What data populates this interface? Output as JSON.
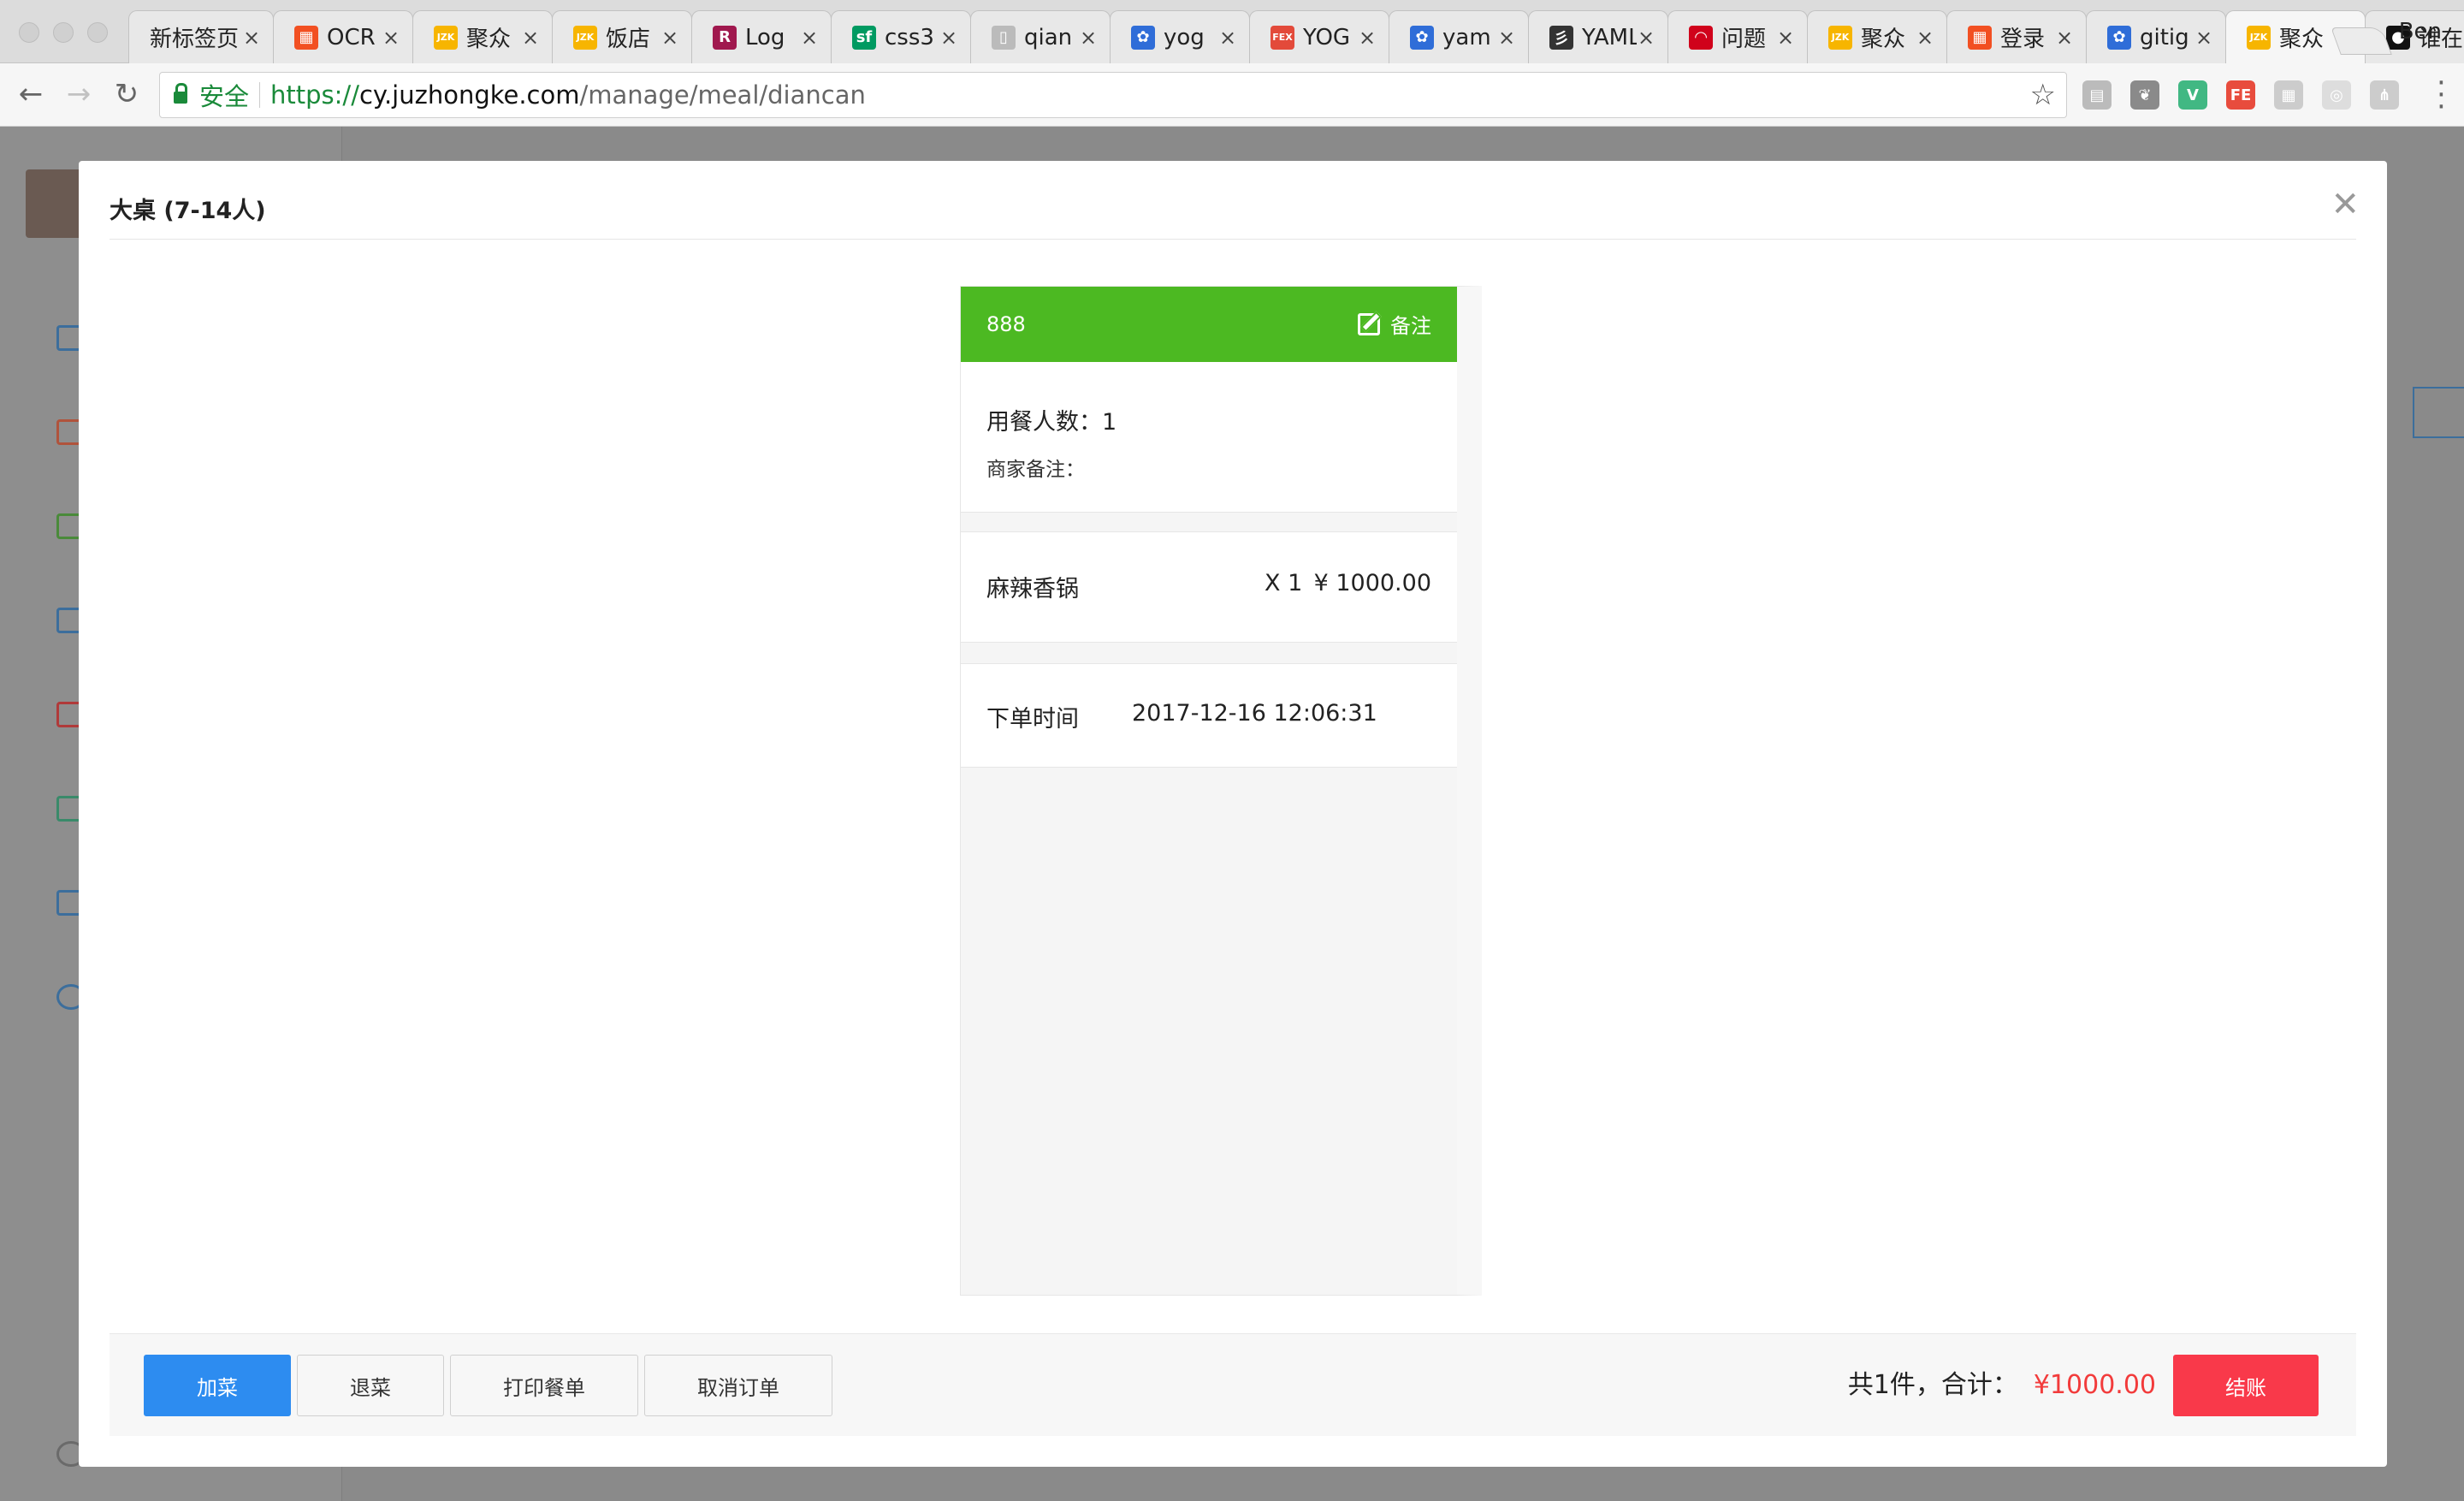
{
  "browser": {
    "tabs": [
      {
        "title": "新标签页",
        "icon": "",
        "icon_color": "#e8e8e8"
      },
      {
        "title": "OCR",
        "icon": "▦",
        "icon_color": "#f25022"
      },
      {
        "title": "聚众",
        "icon": "JZK",
        "icon_color": "#f7b500"
      },
      {
        "title": "饭店",
        "icon": "JZK",
        "icon_color": "#f7b500"
      },
      {
        "title": "Log",
        "icon": "R",
        "icon_color": "#a0184e"
      },
      {
        "title": "css3",
        "icon": "sf",
        "icon_color": "#009a61"
      },
      {
        "title": "qian",
        "icon": "▯",
        "icon_color": "#bbbbbb"
      },
      {
        "title": "yog",
        "icon": "✿",
        "icon_color": "#2f6dd8"
      },
      {
        "title": "YOG",
        "icon": "FEX",
        "icon_color": "#e34a3a"
      },
      {
        "title": "yam",
        "icon": "✿",
        "icon_color": "#2f6dd8"
      },
      {
        "title": "YAML",
        "icon": "彡",
        "icon_color": "#333333"
      },
      {
        "title": "问题",
        "icon": "◠",
        "icon_color": "#d0021b"
      },
      {
        "title": "聚众",
        "icon": "JZK",
        "icon_color": "#f7b500"
      },
      {
        "title": "登录",
        "icon": "▦",
        "icon_color": "#f25022"
      },
      {
        "title": "gitig",
        "icon": "✿",
        "icon_color": "#2f6dd8"
      },
      {
        "title": "聚众",
        "icon": "JZK",
        "icon_color": "#f7b500"
      },
      {
        "title": "谁在",
        "icon": "●",
        "icon_color": "#111111"
      }
    ],
    "profile_name": "Ben",
    "address": {
      "secure_label": "安全",
      "scheme": "https://",
      "host": "cy.juzhongke.com",
      "path": "/manage/meal/diancan"
    },
    "extensions": [
      {
        "name": "reader-icon",
        "label": "▤",
        "color": "#bbbbbb"
      },
      {
        "name": "evernote-icon",
        "label": "❦",
        "color": "#8a8a8a"
      },
      {
        "name": "vue-devtools-icon",
        "label": "V",
        "color": "#41b883"
      },
      {
        "name": "fe-helper-icon",
        "label": "FE",
        "color": "#e84c3d"
      },
      {
        "name": "qr-icon",
        "label": "▦",
        "color": "#cccccc"
      },
      {
        "name": "chrome-ext-icon",
        "label": "◎",
        "color": "#dddddd"
      },
      {
        "name": "tree-icon",
        "label": "⋔",
        "color": "#cccccc"
      }
    ]
  },
  "modal": {
    "title": "大桌 (7-14人)",
    "ticket": {
      "table_no": "888",
      "remark_label": "备注",
      "diners_label": "用餐人数：1",
      "merchant_note_label": "商家备注：",
      "item": {
        "name": "麻辣香锅",
        "qty": "X 1",
        "price": "¥ 1000.00"
      },
      "order_time_label": "下单时间",
      "order_time_value": "2017-12-16 12:06:31"
    },
    "footer": {
      "add_label": "加菜",
      "return_label": "退菜",
      "print_label": "打印餐单",
      "cancel_label": "取消订单",
      "total_label": "共1件，合计：",
      "total_amount": "¥1000.00",
      "checkout_label": "结账"
    }
  },
  "colors": {
    "ticket_header": "#4cb922",
    "primary": "#2d8cf0",
    "danger": "#f9394a",
    "total_amount": "#f23b3b"
  }
}
